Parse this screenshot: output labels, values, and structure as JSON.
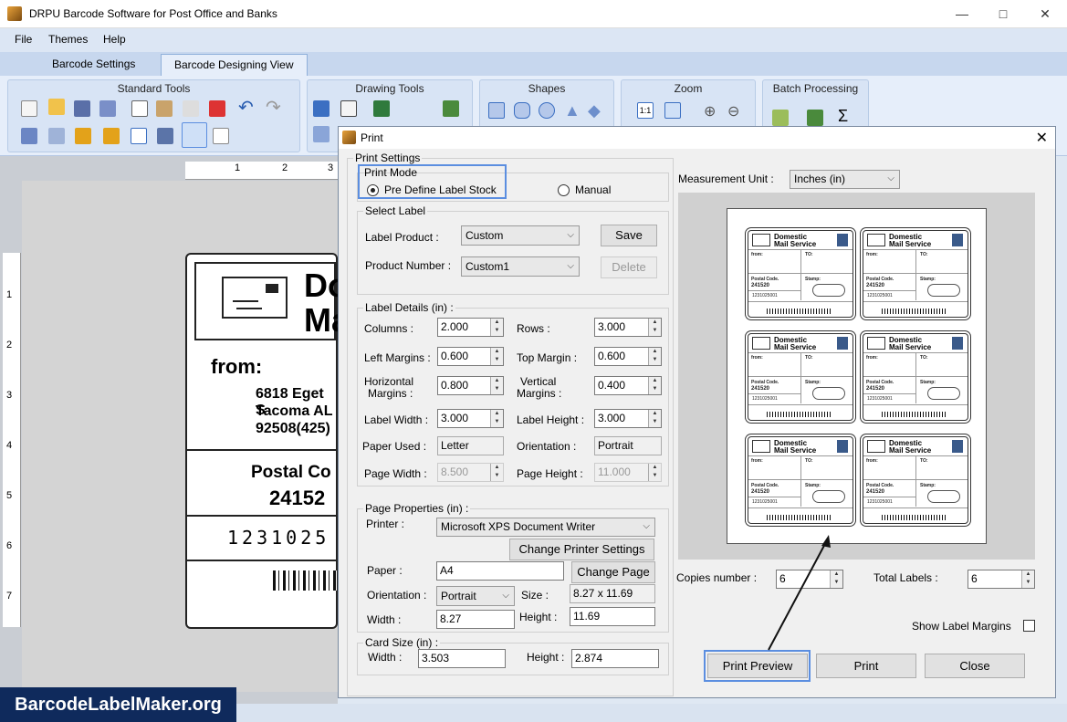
{
  "app": {
    "title": "DRPU Barcode Software for Post Office and Banks"
  },
  "menu": [
    "File",
    "Themes",
    "Help"
  ],
  "tabs": [
    "Barcode Settings",
    "Barcode Designing View"
  ],
  "ribbon": {
    "groups": [
      "Standard Tools",
      "Drawing Tools",
      "Shapes",
      "Zoom",
      "Batch Processing"
    ]
  },
  "label_canvas": {
    "title_lines": [
      "Do",
      "Ma"
    ],
    "from": "from:",
    "address": [
      "6818 Eget S",
      "Tacoma AL",
      "92508(425)"
    ],
    "postal_label": "Postal Co",
    "postal_code": "24152",
    "number_text": "1231025",
    "ruler_h": [
      "1",
      "2",
      "3"
    ],
    "ruler_v": [
      "1",
      "2",
      "3",
      "4",
      "5",
      "6",
      "7"
    ]
  },
  "dialog": {
    "title": "Print",
    "print_settings": "Print Settings",
    "print_mode": {
      "legend": "Print Mode",
      "option1": "Pre Define Label Stock",
      "option2": "Manual",
      "selected": "Pre Define Label Stock"
    },
    "select_label": {
      "legend": "Select Label",
      "label_product_label": "Label Product :",
      "label_product_value": "Custom",
      "product_number_label": "Product Number :",
      "product_number_value": "Custom1",
      "save": "Save",
      "delete": "Delete"
    },
    "label_details": {
      "legend": "Label Details (in) :",
      "columns_label": "Columns :",
      "columns": "2.000",
      "rows_label": "Rows :",
      "rows": "3.000",
      "left_margins_label": "Left Margins :",
      "left_margins": "0.600",
      "top_margin_label": "Top Margin :",
      "top_margin": "0.600",
      "hmargins_label1": "Horizontal",
      "hmargins_label2": "Margins :",
      "hmargins": "0.800",
      "vmargins_label1": "Vertical",
      "vmargins_label2": "Margins :",
      "vmargins": "0.400",
      "label_width_label": "Label Width :",
      "label_width": "3.000",
      "label_height_label": "Label Height :",
      "label_height": "3.000",
      "paper_used_label": "Paper Used :",
      "paper_used": "Letter",
      "orientation_label": "Orientation :",
      "orientation": "Portrait",
      "page_width_label": "Page Width :",
      "page_width": "8.500",
      "page_height_label": "Page Height :",
      "page_height": "11.000"
    },
    "page_properties": {
      "legend": "Page Properties (in) :",
      "printer_label": "Printer :",
      "printer": "Microsoft XPS Document Writer",
      "change_printer": "Change Printer Settings",
      "paper_label": "Paper :",
      "paper": "A4",
      "change_page": "Change Page",
      "orientation_label": "Orientation :",
      "orientation": "Portrait",
      "size_label": "Size :",
      "size": "8.27 x 11.69",
      "width_label": "Width :",
      "width": "8.27",
      "height_label": "Height :",
      "height": "11.69"
    },
    "card_size": {
      "legend": "Card Size (in) :",
      "width_label": "Width :",
      "width": "3.503",
      "height_label": "Height :",
      "height": "2.874"
    },
    "measurement_unit_label": "Measurement Unit :",
    "measurement_unit": "Inches (in)",
    "preview_label": {
      "title1": "Domestic",
      "title2": "Mail Service",
      "from": "from:",
      "to": "TO:",
      "postal": "Postal Code.",
      "code": "241520",
      "stamp": "Stamp:",
      "numbers": "1231025001"
    },
    "copies_label": "Copies number :",
    "copies": "6",
    "total_labels_label": "Total Labels :",
    "total_labels": "6",
    "show_margins_label": "Show Label Margins",
    "buttons": {
      "print_preview": "Print Preview",
      "print": "Print",
      "close": "Close"
    }
  },
  "watermark": "BarcodeLabelMaker.org"
}
